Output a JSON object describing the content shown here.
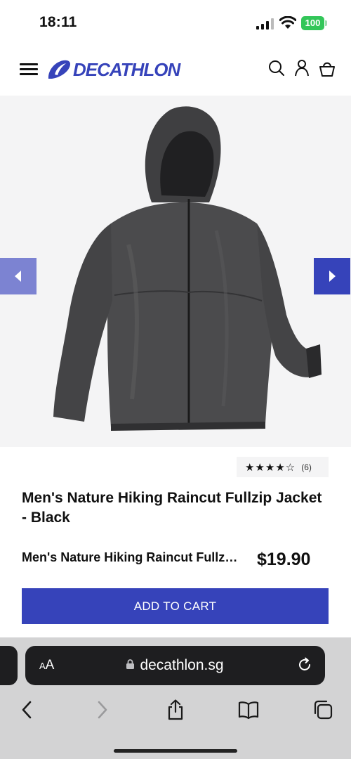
{
  "status_bar": {
    "time": "18:11",
    "battery": "100"
  },
  "header": {
    "brand": "DECATHLON",
    "icons": [
      "menu-icon",
      "search-icon",
      "account-icon",
      "basket-icon"
    ]
  },
  "gallery": {
    "image_alt": "black hooded rain jacket",
    "prev_icon": "chevron-left-icon",
    "next_icon": "chevron-right-icon"
  },
  "product": {
    "rating_stars": "★★★★☆",
    "rating_count": "(6)",
    "title": "Men's Nature Hiking Raincut Fullzip Jacket - Black",
    "sticky_name": "Men's Nature Hiking Raincut Fullzip Jacket - Black",
    "price": "$19.90",
    "add_to_cart": "ADD TO CART"
  },
  "browser": {
    "aa_label": "AA",
    "url": "decathlon.sg",
    "toolbar": [
      "back-icon",
      "forward-icon",
      "share-icon",
      "bookmarks-icon",
      "tabs-icon"
    ]
  },
  "colors": {
    "brand_blue": "#3643ba",
    "brand_blue_light": "#7c83d2",
    "battery_green": "#33c659"
  }
}
